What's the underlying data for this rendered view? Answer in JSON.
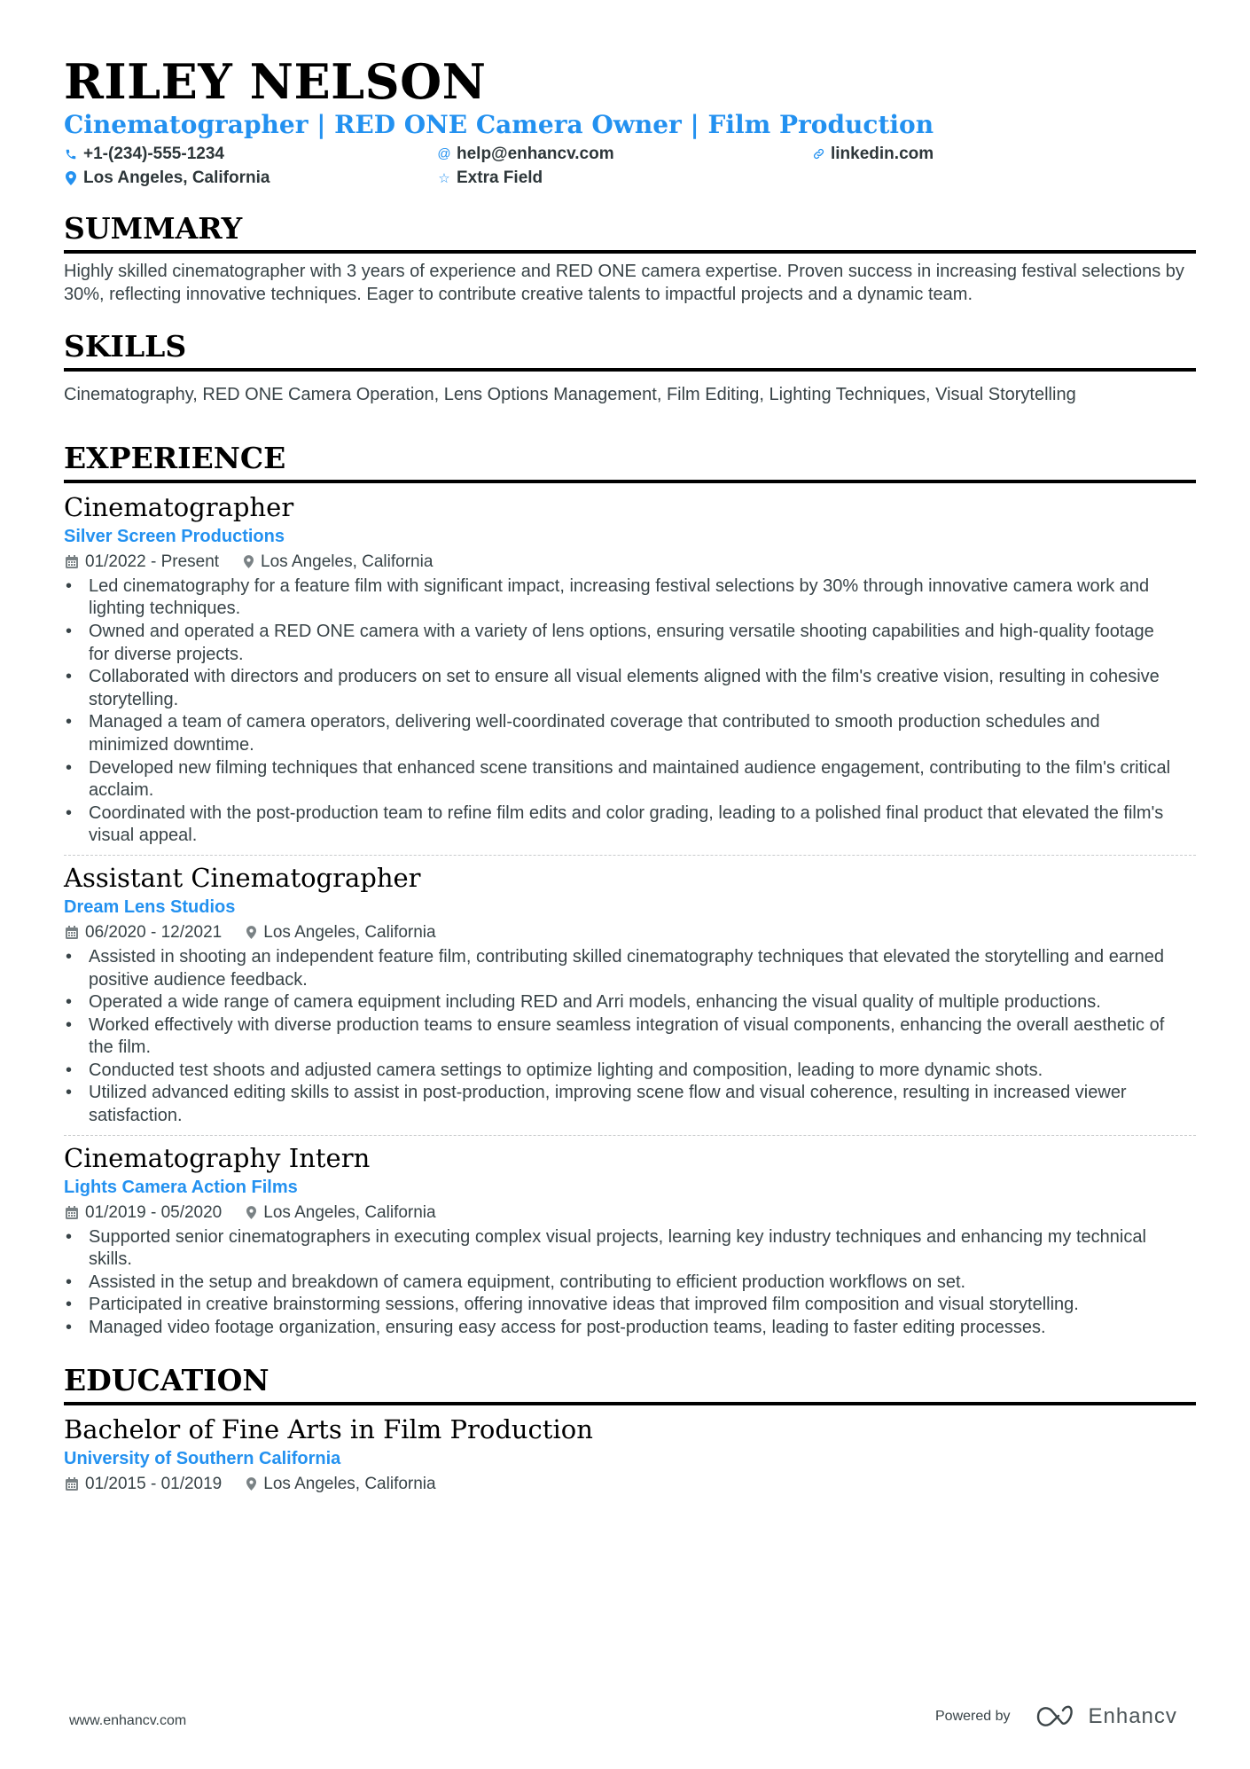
{
  "header": {
    "name": "RILEY NELSON",
    "title": "Cinematographer | RED ONE Camera Owner | Film Production",
    "contacts": [
      {
        "icon": "phone-icon",
        "glyph": "✆",
        "text": "+1-(234)-555-1234"
      },
      {
        "icon": "at-icon",
        "glyph": "@",
        "text": "help@enhancv.com"
      },
      {
        "icon": "link-icon",
        "glyph": "🔗",
        "text": "linkedin.com"
      },
      {
        "icon": "location-pin-icon",
        "glyph": "●",
        "text": "Los Angeles, California"
      },
      {
        "icon": "star-icon",
        "glyph": "☆",
        "text": "Extra Field"
      }
    ]
  },
  "summary": {
    "heading": "SUMMARY",
    "text": "Highly skilled cinematographer with 3 years of experience and RED ONE camera expertise. Proven success in increasing festival selections by 30%, reflecting innovative techniques. Eager to contribute creative talents to impactful projects and a dynamic team."
  },
  "skills": {
    "heading": "SKILLS",
    "text": "Cinematography, RED ONE Camera Operation, Lens Options Management, Film Editing, Lighting Techniques, Visual Storytelling"
  },
  "experience": {
    "heading": "EXPERIENCE",
    "jobs": [
      {
        "role": "Cinematographer",
        "company": "Silver Screen Productions",
        "dates": "01/2022 - Present",
        "location": "Los Angeles, California",
        "bullets": [
          "Led cinematography for a feature film with significant impact, increasing festival selections by 30% through innovative camera work and lighting techniques.",
          "Owned and operated a RED ONE camera with a variety of lens options, ensuring versatile shooting capabilities and high-quality footage for diverse projects.",
          "Collaborated with directors and producers on set to ensure all visual elements aligned with the film's creative vision, resulting in cohesive storytelling.",
          "Managed a team of camera operators, delivering well-coordinated coverage that contributed to smooth production schedules and minimized downtime.",
          "Developed new filming techniques that enhanced scene transitions and maintained audience engagement, contributing to the film's critical acclaim.",
          "Coordinated with the post-production team to refine film edits and color grading, leading to a polished final product that elevated the film's visual appeal."
        ]
      },
      {
        "role": "Assistant Cinematographer",
        "company": "Dream Lens Studios",
        "dates": "06/2020 - 12/2021",
        "location": "Los Angeles, California",
        "bullets": [
          "Assisted in shooting an independent feature film, contributing skilled cinematography techniques that elevated the storytelling and earned positive audience feedback.",
          "Operated a wide range of camera equipment including RED and Arri models, enhancing the visual quality of multiple productions.",
          "Worked effectively with diverse production teams to ensure seamless integration of visual components, enhancing the overall aesthetic of the film.",
          "Conducted test shoots and adjusted camera settings to optimize lighting and composition, leading to more dynamic shots.",
          "Utilized advanced editing skills to assist in post-production, improving scene flow and visual coherence, resulting in increased viewer satisfaction."
        ]
      },
      {
        "role": "Cinematography Intern",
        "company": "Lights Camera Action Films",
        "dates": "01/2019 - 05/2020",
        "location": "Los Angeles, California",
        "bullets": [
          "Supported senior cinematographers in executing complex visual projects, learning key industry techniques and enhancing my technical skills.",
          "Assisted in the setup and breakdown of camera equipment, contributing to efficient production workflows on set.",
          "Participated in creative brainstorming sessions, offering innovative ideas that improved film composition and visual storytelling.",
          "Managed video footage organization, ensuring easy access for post-production teams, leading to faster editing processes."
        ]
      }
    ]
  },
  "education": {
    "heading": "EDUCATION",
    "degree": "Bachelor of Fine Arts in Film Production",
    "school": "University of Southern California",
    "dates": "01/2015 - 01/2019",
    "location": "Los Angeles, California"
  },
  "footer": {
    "website": "www.enhancv.com",
    "powered_by": "Powered by",
    "brand": "Enhancv"
  },
  "colors": {
    "accent": "#2391f0",
    "text": "#384347",
    "heading": "#000000"
  }
}
